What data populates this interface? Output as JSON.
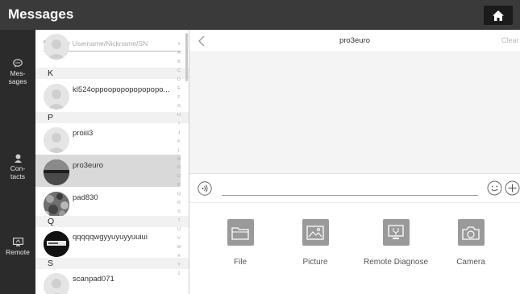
{
  "header": {
    "title": "Messages",
    "home_icon": "home-icon"
  },
  "nav_rail": {
    "items": [
      {
        "id": "messages",
        "label_line1": "Mes-",
        "label_line2": "sages",
        "icon": "chat-bubble-icon"
      },
      {
        "id": "contacts",
        "label_line1": "Con-",
        "label_line2": "tacts",
        "icon": "person-icon"
      },
      {
        "id": "remote",
        "label_line1": "Remote",
        "label_line2": "",
        "icon": "remote-screen-icon"
      }
    ]
  },
  "contacts_panel": {
    "search": {
      "placeholder": "Enter Username/Nickname/SN",
      "value": ""
    },
    "sections": [
      {
        "letter": "K",
        "contacts": [
          {
            "name": "kl524oppoopopopopopopo..."
          }
        ]
      },
      {
        "letter": "P",
        "contacts": [
          {
            "name": "proiii3"
          },
          {
            "name": "pro3euro"
          },
          {
            "name": "pad830"
          }
        ]
      },
      {
        "letter": "Q",
        "contacts": [
          {
            "name": "qqqqqwgyyuyuyyuuiui"
          }
        ]
      },
      {
        "letter": "S",
        "contacts": [
          {
            "name": "scanpad071"
          }
        ]
      }
    ],
    "selected_contact": "pro3euro",
    "index_letters": [
      "#",
      "A",
      "B",
      "C",
      "D",
      "E",
      "F",
      "G",
      "H",
      "I",
      "J",
      "K",
      "L",
      "M",
      "N",
      "O",
      "P",
      "Q",
      "R",
      "S",
      "T",
      "U",
      "V",
      "W",
      "X",
      "Y",
      "Z"
    ]
  },
  "chat": {
    "title": "pro3euro",
    "clear_label": "Clear",
    "input": {
      "value": "",
      "placeholder": ""
    },
    "tools": [
      {
        "label": "File",
        "icon": "folder-icon"
      },
      {
        "label": "Picture",
        "icon": "picture-icon"
      },
      {
        "label": "Remote Diagnose",
        "icon": "remote-diagnose-icon"
      },
      {
        "label": "Camera",
        "icon": "camera-icon"
      }
    ]
  },
  "colors": {
    "topbar": "#3a3a3a",
    "rail": "#2b2b2b",
    "selected_row": "#d9d9d9",
    "tool_icon_bg": "#9a9a9a"
  }
}
